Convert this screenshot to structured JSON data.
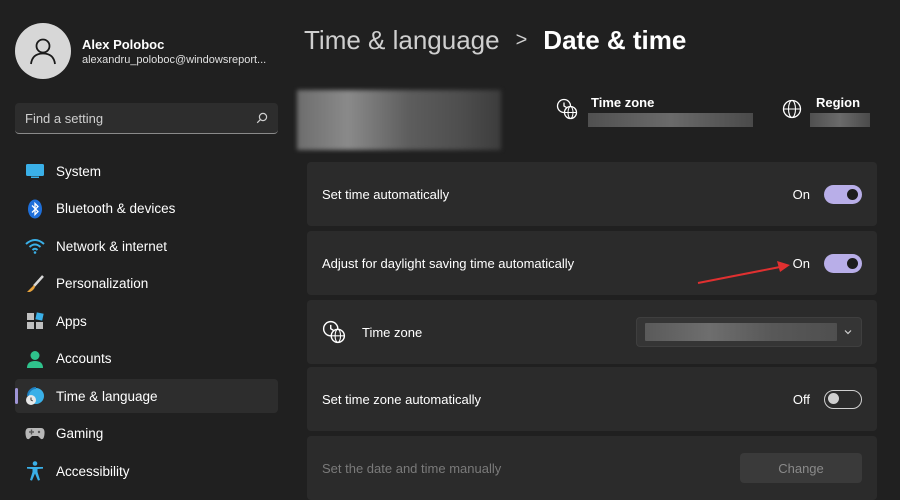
{
  "user": {
    "name": "Alex Poloboc",
    "email": "alexandru_poloboc@windowsreport..."
  },
  "search": {
    "placeholder": "Find a setting",
    "icon": "search-icon"
  },
  "sidebar": {
    "items": [
      {
        "label": "System",
        "icon": "system-icon",
        "active": false
      },
      {
        "label": "Bluetooth & devices",
        "icon": "bluetooth-icon",
        "active": false
      },
      {
        "label": "Network & internet",
        "icon": "wifi-icon",
        "active": false
      },
      {
        "label": "Personalization",
        "icon": "brush-icon",
        "active": false
      },
      {
        "label": "Apps",
        "icon": "apps-icon",
        "active": false
      },
      {
        "label": "Accounts",
        "icon": "accounts-icon",
        "active": false
      },
      {
        "label": "Time & language",
        "icon": "clock-globe-icon",
        "active": true
      },
      {
        "label": "Gaming",
        "icon": "gamepad-icon",
        "active": false
      },
      {
        "label": "Accessibility",
        "icon": "accessibility-icon",
        "active": false
      }
    ]
  },
  "breadcrumb": {
    "parent": "Time & language",
    "separator": ">",
    "current": "Date & time"
  },
  "header_info": {
    "time_zone_label": "Time zone",
    "region_label": "Region"
  },
  "settings": {
    "set_time_auto": {
      "label": "Set time automatically",
      "state": "On"
    },
    "daylight_saving": {
      "label": "Adjust for daylight saving time automatically",
      "state": "On"
    },
    "time_zone": {
      "label": "Time zone"
    },
    "set_time_zone_auto": {
      "label": "Set time zone automatically",
      "state": "Off"
    },
    "manual": {
      "label": "Set the date and time manually",
      "button_label": "Change"
    }
  },
  "colors": {
    "background": "#202020",
    "card": "#2b2b2b",
    "accent": "#b8aee8",
    "annotation_arrow": "#e03030"
  }
}
